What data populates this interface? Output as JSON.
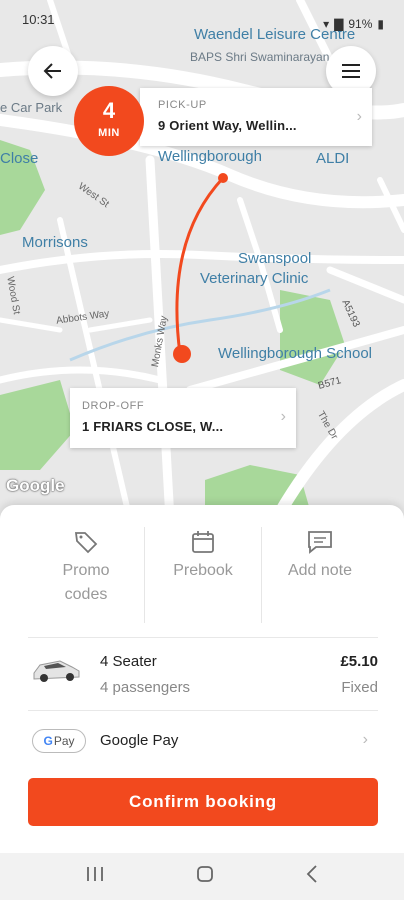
{
  "status_bar": {
    "time": "10:31",
    "battery": "91%"
  },
  "map": {
    "labels": {
      "waendel": "Waendel Leisure Centre",
      "baps": "BAPS Shri Swaminarayan",
      "car_park": "e Car Park",
      "close": "Close",
      "wellingborough": "Wellingborough",
      "aldi": "ALDI",
      "west_st": "West St",
      "morrisons": "Morrisons",
      "swanspool": "Swanspool",
      "vet": "Veterinary Clinic",
      "wood_st": "Wood St",
      "abbots_way": "Abbots Way",
      "monks_way": "Monks Way",
      "a5193": "A5193",
      "school": "Wellingborough School",
      "b571": "B571",
      "the_dr": "The Dr"
    },
    "google": "Google"
  },
  "eta": {
    "value": "4",
    "unit": "MIN"
  },
  "pickup": {
    "label": "PICK-UP",
    "address": "9 Orient Way, Wellin..."
  },
  "dropoff": {
    "label": "DROP-OFF",
    "address": "1 FRIARS CLOSE, W..."
  },
  "options": [
    {
      "label": "Promo codes",
      "icon": "tag-icon"
    },
    {
      "label": "Prebook",
      "icon": "calendar-icon"
    },
    {
      "label": "Add note",
      "icon": "message-icon"
    }
  ],
  "vehicle": {
    "name": "4 Seater",
    "capacity": "4 passengers",
    "price": "£5.10",
    "price_type": "Fixed"
  },
  "payment": {
    "badge": "Pay",
    "method": "Google Pay"
  },
  "confirm_label": "Confirm booking",
  "colors": {
    "accent": "#f2491e",
    "map_bg": "#e8e8e8",
    "park": "#a8d89a"
  }
}
